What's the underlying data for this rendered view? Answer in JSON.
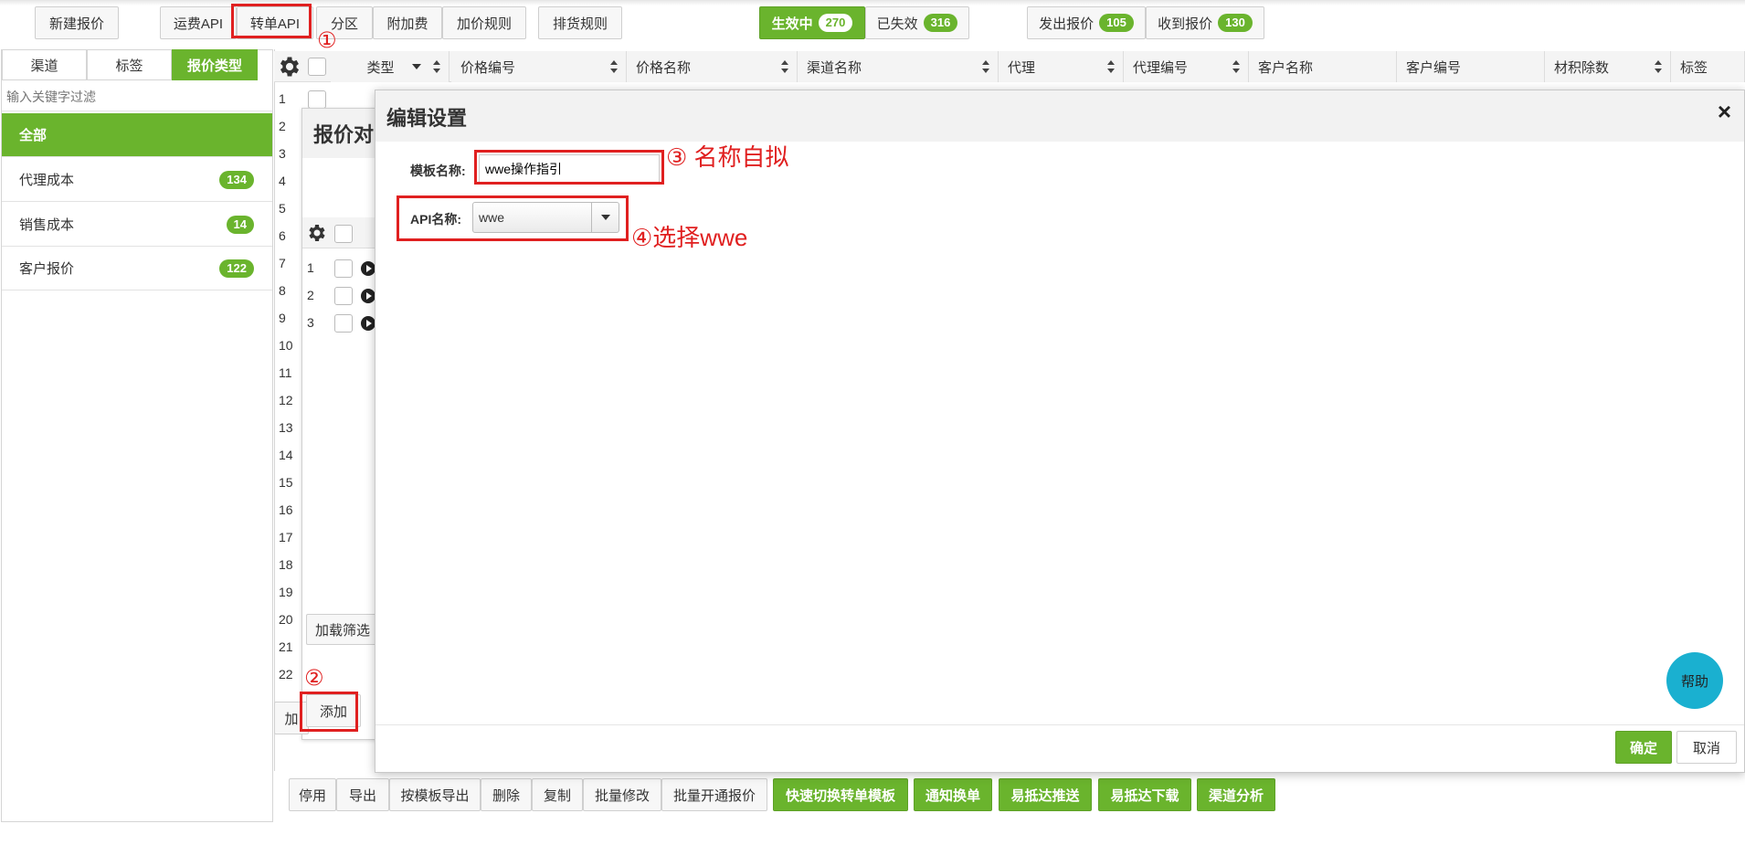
{
  "toolbar": {
    "new_quote": "新建报价",
    "freight_api": "运费API",
    "transfer_api": "转单API",
    "zone": "分区",
    "surcharge": "附加费",
    "markup_rule": "加价规则",
    "sort_rule": "排货规则"
  },
  "status_tabs": {
    "active_label": "生效中",
    "active_count": "270",
    "expired_label": "已失效",
    "expired_count": "316",
    "sent_label": "发出报价",
    "sent_count": "105",
    "received_label": "收到报价",
    "received_count": "130"
  },
  "sidebar": {
    "tabs": [
      "渠道",
      "标签",
      "报价类型"
    ],
    "filter_placeholder": "输入关键字过滤",
    "items": [
      {
        "label": "全部",
        "count": ""
      },
      {
        "label": "代理成本",
        "count": "134"
      },
      {
        "label": "销售成本",
        "count": "14"
      },
      {
        "label": "客户报价",
        "count": "122"
      }
    ]
  },
  "table": {
    "columns": [
      "类型",
      "价格编号",
      "价格名称",
      "渠道名称",
      "代理",
      "代理编号",
      "客户名称",
      "客户编号",
      "材积除数",
      "标签"
    ],
    "row_numbers": [
      "1",
      "2",
      "3",
      "4",
      "5",
      "6",
      "7",
      "8",
      "9",
      "10",
      "11",
      "12",
      "13",
      "14",
      "15",
      "16",
      "17",
      "18",
      "19",
      "20",
      "21",
      "22"
    ]
  },
  "background_panel": {
    "title": "报价对",
    "rows": [
      "1",
      "2",
      "3"
    ],
    "load_filter": "加载筛选",
    "add": "添加",
    "partial_label": "加"
  },
  "modal": {
    "title": "编辑设置",
    "close": "×",
    "template_label": "模板名称:",
    "template_value": "wwe操作指引",
    "api_label": "API名称:",
    "api_value": "wwe",
    "confirm": "确定",
    "cancel": "取消",
    "help": "帮助"
  },
  "bottom_toolbar": {
    "buttons": [
      "停用",
      "导出",
      "按模板导出",
      "删除",
      "复制",
      "批量修改",
      "批量开通报价"
    ],
    "green_buttons": [
      "快速切换转单模板",
      "通知换单",
      "易抵达推送",
      "易抵达下载",
      "渠道分析"
    ]
  },
  "annotations": {
    "step1": "①",
    "step2": "②",
    "step3": "③ 名称自拟",
    "step4": "④选择wwe"
  },
  "colors": {
    "accent": "#6ab42d",
    "annotation": "#e02020",
    "help": "#1ab0d0"
  }
}
